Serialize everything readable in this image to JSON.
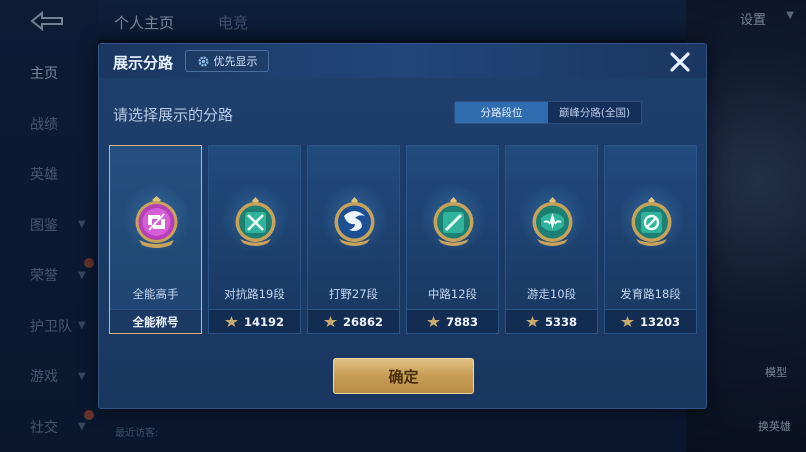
{
  "background": {
    "top_tabs": [
      "个人主页",
      "电竞"
    ],
    "settings_label": "设置",
    "side_nav": [
      {
        "label": "主页",
        "active": true
      },
      {
        "label": "战绩"
      },
      {
        "label": "英雄"
      },
      {
        "label": "图鉴",
        "chevron": true
      },
      {
        "label": "荣誉",
        "chevron": true,
        "badge": true
      },
      {
        "label": "护卫队",
        "chevron": true
      },
      {
        "label": "游戏",
        "chevron": true
      },
      {
        "label": "社交",
        "chevron": true,
        "badge": true
      }
    ],
    "right_labels": [
      "模型",
      "换英雄"
    ],
    "recent_visitors": "最近访客:"
  },
  "modal": {
    "title": "展示分路",
    "priority_button": "优先显示",
    "subtitle": "请选择展示的分路",
    "toggle": {
      "options": [
        "分路段位",
        "巅峰分路(全国)"
      ],
      "selected": 0
    },
    "cards": [
      {
        "name": "全能高手",
        "bottom": "全能称号",
        "emblem": "purple-allround-emblem",
        "selected": true
      },
      {
        "name": "对抗路19段",
        "bottom": "14192",
        "emblem": "clash-lane-emblem"
      },
      {
        "name": "打野27段",
        "bottom": "26862",
        "emblem": "jungle-dragon-emblem"
      },
      {
        "name": "中路12段",
        "bottom": "7883",
        "emblem": "mid-lane-emblem"
      },
      {
        "name": "游走10段",
        "bottom": "5338",
        "emblem": "roam-emblem"
      },
      {
        "name": "发育路18段",
        "bottom": "13203",
        "emblem": "farm-lane-emblem"
      }
    ],
    "confirm_button": "确定"
  },
  "colors": {
    "accent_gold": "#d9b477",
    "emblem_teal": "#2fb39a",
    "emblem_purple": "#b43fb8",
    "toggle_active": "#2f6cb0"
  }
}
